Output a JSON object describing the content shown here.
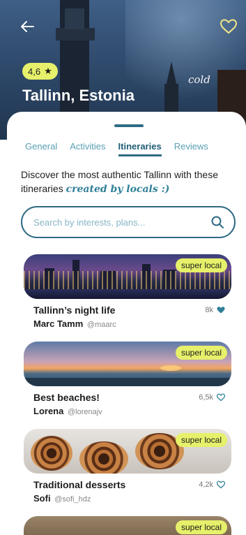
{
  "header": {
    "rating": "4,6",
    "city": "Tallinn, Estonia",
    "photo_caption": "cold"
  },
  "tabs": [
    "General",
    "Activities",
    "Itineraries",
    "Reviews"
  ],
  "intro": {
    "text": "Discover the most authentic Tallinn with these itineraries",
    "highlight": "created by locals :)"
  },
  "search": {
    "placeholder": "Search by interests, plans..."
  },
  "itineraries": [
    {
      "title": "Tallinn’s night life",
      "author": "Marc Tamm",
      "handle": "@maarc",
      "likes": "8k",
      "badge": "super local",
      "liked": true
    },
    {
      "title": "Best beaches!",
      "author": "Lorena",
      "handle": "@lorenajv",
      "likes": "6,5k",
      "badge": "super local",
      "liked": false
    },
    {
      "title": "Traditional desserts",
      "author": "Sofi",
      "handle": "@sofi_hdz",
      "likes": "4,2k",
      "badge": "super local",
      "liked": false
    },
    {
      "badge": "super local"
    }
  ],
  "colors": {
    "primary": "#2f6b84",
    "accent": "#e6f06a",
    "tab_inactive": "#5aa0b5",
    "highlight": "#2f7f98"
  }
}
